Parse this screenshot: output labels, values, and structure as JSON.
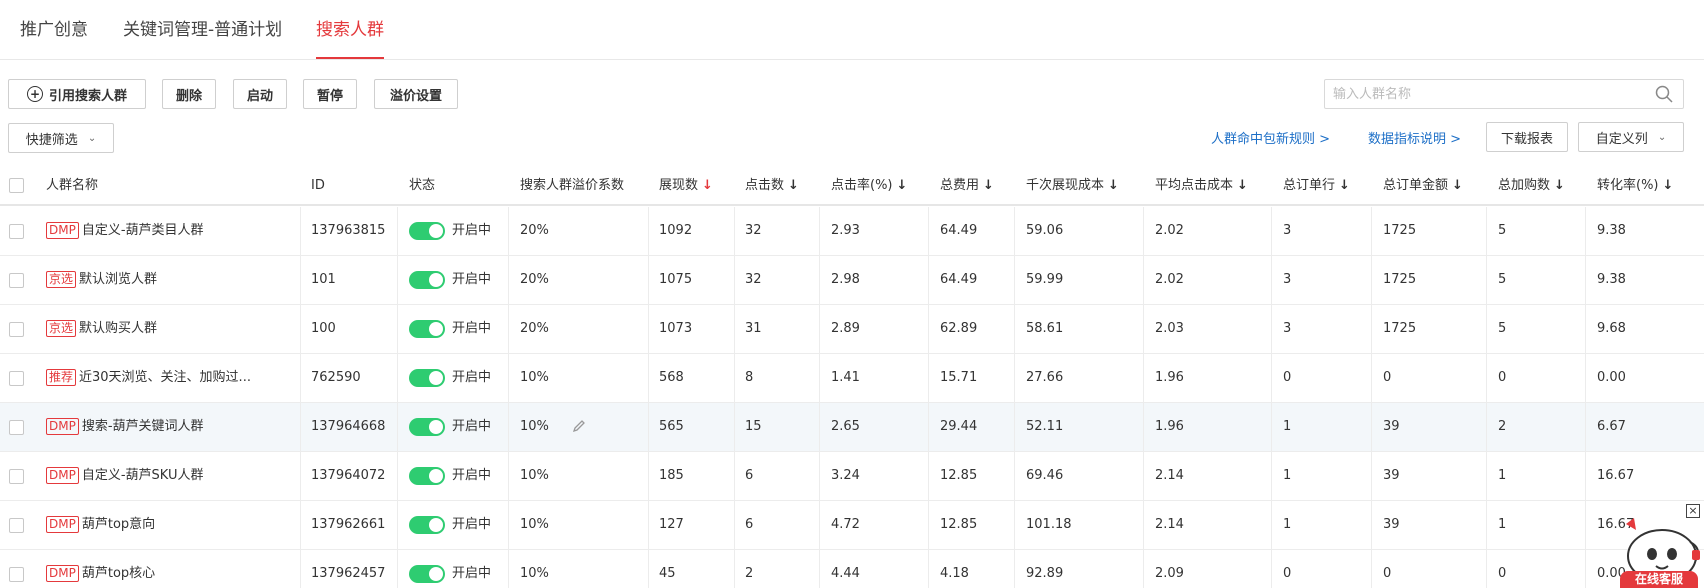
{
  "tabs": [
    {
      "label": "推广创意",
      "active": false
    },
    {
      "label": "关键词管理-普通计划",
      "active": false
    },
    {
      "label": "搜索人群",
      "active": true
    }
  ],
  "accent_color": "#e4393c",
  "toolbar": {
    "cite_label": "引用搜索人群",
    "delete_label": "删除",
    "start_label": "启动",
    "pause_label": "暂停",
    "premium_label": "溢价设置",
    "quick_filter_label": "快捷筛选",
    "search_placeholder": "输入人群名称",
    "link_rules": "人群命中包新规则 >",
    "link_metrics": "数据指标说明 >",
    "download_label": "下载报表",
    "custom_columns_label": "自定义列"
  },
  "table": {
    "headers": [
      "人群名称",
      "ID",
      "状态",
      "搜索人群溢价系数",
      "展现数",
      "点击数",
      "点击率(%)",
      "总费用",
      "千次展现成本",
      "平均点击成本",
      "总订单行",
      "总订单金额",
      "总加购数",
      "转化率(%)"
    ],
    "sort_arrow": "↓",
    "rows": [
      {
        "tag": "DMP",
        "name": "自定义-葫芦类目人群",
        "id": "137963815",
        "status": "开启中",
        "premium": "20%",
        "impressions": "1092",
        "clicks": "32",
        "ctr": "2.93",
        "cost": "64.49",
        "cpm": "59.06",
        "cpc": "2.02",
        "orders": "3",
        "order_amount": "1725",
        "carts": "5",
        "cvr": "9.38",
        "enabled": true
      },
      {
        "tag": "京选",
        "name": "默认浏览人群",
        "id": "101",
        "status": "开启中",
        "premium": "20%",
        "impressions": "1075",
        "clicks": "32",
        "ctr": "2.98",
        "cost": "64.49",
        "cpm": "59.99",
        "cpc": "2.02",
        "orders": "3",
        "order_amount": "1725",
        "carts": "5",
        "cvr": "9.38",
        "enabled": true
      },
      {
        "tag": "京选",
        "name": "默认购买人群",
        "id": "100",
        "status": "开启中",
        "premium": "20%",
        "impressions": "1073",
        "clicks": "31",
        "ctr": "2.89",
        "cost": "62.89",
        "cpm": "58.61",
        "cpc": "2.03",
        "orders": "3",
        "order_amount": "1725",
        "carts": "5",
        "cvr": "9.68",
        "enabled": true
      },
      {
        "tag": "推荐",
        "name": "近30天浏览、关注、加购过...",
        "id": "762590",
        "status": "开启中",
        "premium": "10%",
        "impressions": "568",
        "clicks": "8",
        "ctr": "1.41",
        "cost": "15.71",
        "cpm": "27.66",
        "cpc": "1.96",
        "orders": "0",
        "order_amount": "0",
        "carts": "0",
        "cvr": "0.00",
        "enabled": true
      },
      {
        "tag": "DMP",
        "name": "搜索-葫芦关键词人群",
        "id": "137964668",
        "status": "开启中",
        "premium": "10%",
        "impressions": "565",
        "clicks": "15",
        "ctr": "2.65",
        "cost": "29.44",
        "cpm": "52.11",
        "cpc": "1.96",
        "orders": "1",
        "order_amount": "39",
        "carts": "2",
        "cvr": "6.67",
        "enabled": true
      },
      {
        "tag": "DMP",
        "name": "自定义-葫芦SKU人群",
        "id": "137964072",
        "status": "开启中",
        "premium": "10%",
        "impressions": "185",
        "clicks": "6",
        "ctr": "3.24",
        "cost": "12.85",
        "cpm": "69.46",
        "cpc": "2.14",
        "orders": "1",
        "order_amount": "39",
        "carts": "1",
        "cvr": "16.67",
        "enabled": true
      },
      {
        "tag": "DMP",
        "name": "葫芦top意向",
        "id": "137962661",
        "status": "开启中",
        "premium": "10%",
        "impressions": "127",
        "clicks": "6",
        "ctr": "4.72",
        "cost": "12.85",
        "cpm": "101.18",
        "cpc": "2.14",
        "orders": "1",
        "order_amount": "39",
        "carts": "1",
        "cvr": "16.67",
        "enabled": true
      },
      {
        "tag": "DMP",
        "name": "葫芦top核心",
        "id": "137962457",
        "status": "开启中",
        "premium": "10%",
        "impressions": "45",
        "clicks": "2",
        "ctr": "4.44",
        "cost": "4.18",
        "cpm": "92.89",
        "cpc": "2.09",
        "orders": "0",
        "order_amount": "0",
        "carts": "0",
        "cvr": "0.00",
        "enabled": true
      }
    ]
  },
  "customer_service": {
    "label": "在线客服",
    "close": "×"
  }
}
